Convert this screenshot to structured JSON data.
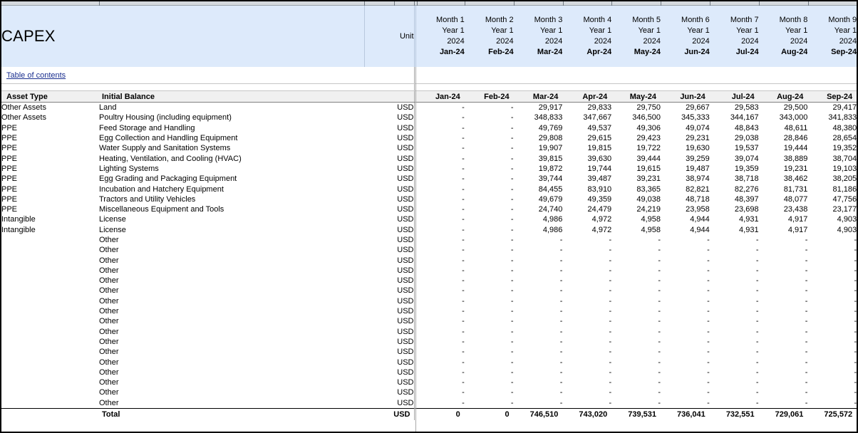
{
  "header": {
    "title": "CAPEX",
    "unit_label": "Unit",
    "toc_link": "Table of contents",
    "months": [
      {
        "month": "Month 1",
        "year_label": "Year 1",
        "year": "2024",
        "date": "Jan-24"
      },
      {
        "month": "Month 2",
        "year_label": "Year 1",
        "year": "2024",
        "date": "Feb-24"
      },
      {
        "month": "Month 3",
        "year_label": "Year 1",
        "year": "2024",
        "date": "Mar-24"
      },
      {
        "month": "Month 4",
        "year_label": "Year 1",
        "year": "2024",
        "date": "Apr-24"
      },
      {
        "month": "Month 5",
        "year_label": "Year 1",
        "year": "2024",
        "date": "May-24"
      },
      {
        "month": "Month 6",
        "year_label": "Year 1",
        "year": "2024",
        "date": "Jun-24"
      },
      {
        "month": "Month 7",
        "year_label": "Year 1",
        "year": "2024",
        "date": "Jul-24"
      },
      {
        "month": "Month 8",
        "year_label": "Year 1",
        "year": "2024",
        "date": "Aug-24"
      },
      {
        "month": "Month 9",
        "year_label": "Year 1",
        "year": "2024",
        "date": "Sep-24"
      }
    ]
  },
  "table": {
    "columns": {
      "asset_type": "Asset Type",
      "initial_balance": "Initial Balance",
      "unit": "",
      "months": [
        "Jan-24",
        "Feb-24",
        "Mar-24",
        "Apr-24",
        "May-24",
        "Jun-24",
        "Jul-24",
        "Aug-24",
        "Sep-24"
      ]
    },
    "rows": [
      {
        "type": "Other Assets",
        "desc": "Land",
        "unit": "USD",
        "values": [
          "-",
          "-",
          "29,917",
          "29,833",
          "29,750",
          "29,667",
          "29,583",
          "29,500",
          "29,417"
        ]
      },
      {
        "type": "Other Assets",
        "desc": "Poultry Housing (including equipment)",
        "unit": "USD",
        "values": [
          "-",
          "-",
          "348,833",
          "347,667",
          "346,500",
          "345,333",
          "344,167",
          "343,000",
          "341,833"
        ]
      },
      {
        "type": "PPE",
        "desc": "Feed Storage and Handling",
        "unit": "USD",
        "values": [
          "-",
          "-",
          "49,769",
          "49,537",
          "49,306",
          "49,074",
          "48,843",
          "48,611",
          "48,380"
        ]
      },
      {
        "type": "PPE",
        "desc": "Egg Collection and Handling Equipment",
        "unit": "USD",
        "values": [
          "-",
          "-",
          "29,808",
          "29,615",
          "29,423",
          "29,231",
          "29,038",
          "28,846",
          "28,654"
        ]
      },
      {
        "type": "PPE",
        "desc": "Water Supply and Sanitation Systems",
        "unit": "USD",
        "values": [
          "-",
          "-",
          "19,907",
          "19,815",
          "19,722",
          "19,630",
          "19,537",
          "19,444",
          "19,352"
        ]
      },
      {
        "type": "PPE",
        "desc": "Heating, Ventilation, and Cooling (HVAC)",
        "unit": "USD",
        "values": [
          "-",
          "-",
          "39,815",
          "39,630",
          "39,444",
          "39,259",
          "39,074",
          "38,889",
          "38,704"
        ]
      },
      {
        "type": "PPE",
        "desc": "Lighting Systems",
        "unit": "USD",
        "values": [
          "-",
          "-",
          "19,872",
          "19,744",
          "19,615",
          "19,487",
          "19,359",
          "19,231",
          "19,103"
        ]
      },
      {
        "type": "PPE",
        "desc": "Egg Grading and Packaging Equipment",
        "unit": "USD",
        "values": [
          "-",
          "-",
          "39,744",
          "39,487",
          "39,231",
          "38,974",
          "38,718",
          "38,462",
          "38,205"
        ]
      },
      {
        "type": "PPE",
        "desc": "Incubation and Hatchery Equipment",
        "unit": "USD",
        "values": [
          "-",
          "-",
          "84,455",
          "83,910",
          "83,365",
          "82,821",
          "82,276",
          "81,731",
          "81,186"
        ]
      },
      {
        "type": "PPE",
        "desc": "Tractors and Utility Vehicles",
        "unit": "USD",
        "values": [
          "-",
          "-",
          "49,679",
          "49,359",
          "49,038",
          "48,718",
          "48,397",
          "48,077",
          "47,756"
        ]
      },
      {
        "type": "PPE",
        "desc": "Miscellaneous Equipment and Tools",
        "unit": "USD",
        "values": [
          "-",
          "-",
          "24,740",
          "24,479",
          "24,219",
          "23,958",
          "23,698",
          "23,438",
          "23,177"
        ]
      },
      {
        "type": "Intangible",
        "desc": "License",
        "unit": "USD",
        "values": [
          "-",
          "-",
          "4,986",
          "4,972",
          "4,958",
          "4,944",
          "4,931",
          "4,917",
          "4,903"
        ]
      },
      {
        "type": "Intangible",
        "desc": "License",
        "unit": "USD",
        "values": [
          "-",
          "-",
          "4,986",
          "4,972",
          "4,958",
          "4,944",
          "4,931",
          "4,917",
          "4,903"
        ]
      },
      {
        "type": "",
        "desc": "Other",
        "unit": "USD",
        "values": [
          "-",
          "-",
          "-",
          "-",
          "-",
          "-",
          "-",
          "-",
          "-"
        ]
      },
      {
        "type": "",
        "desc": "Other",
        "unit": "USD",
        "values": [
          "-",
          "-",
          "-",
          "-",
          "-",
          "-",
          "-",
          "-",
          "-"
        ]
      },
      {
        "type": "",
        "desc": "Other",
        "unit": "USD",
        "values": [
          "-",
          "-",
          "-",
          "-",
          "-",
          "-",
          "-",
          "-",
          "-"
        ]
      },
      {
        "type": "",
        "desc": "Other",
        "unit": "USD",
        "values": [
          "-",
          "-",
          "-",
          "-",
          "-",
          "-",
          "-",
          "-",
          "-"
        ]
      },
      {
        "type": "",
        "desc": "Other",
        "unit": "USD",
        "values": [
          "-",
          "-",
          "-",
          "-",
          "-",
          "-",
          "-",
          "-",
          "-"
        ]
      },
      {
        "type": "",
        "desc": "Other",
        "unit": "USD",
        "values": [
          "-",
          "-",
          "-",
          "-",
          "-",
          "-",
          "-",
          "-",
          "-"
        ]
      },
      {
        "type": "",
        "desc": "Other",
        "unit": "USD",
        "values": [
          "-",
          "-",
          "-",
          "-",
          "-",
          "-",
          "-",
          "-",
          "-"
        ]
      },
      {
        "type": "",
        "desc": "Other",
        "unit": "USD",
        "values": [
          "-",
          "-",
          "-",
          "-",
          "-",
          "-",
          "-",
          "-",
          "-"
        ]
      },
      {
        "type": "",
        "desc": "Other",
        "unit": "USD",
        "values": [
          "-",
          "-",
          "-",
          "-",
          "-",
          "-",
          "-",
          "-",
          "-"
        ]
      },
      {
        "type": "",
        "desc": "Other",
        "unit": "USD",
        "values": [
          "-",
          "-",
          "-",
          "-",
          "-",
          "-",
          "-",
          "-",
          "-"
        ]
      },
      {
        "type": "",
        "desc": "Other",
        "unit": "USD",
        "values": [
          "-",
          "-",
          "-",
          "-",
          "-",
          "-",
          "-",
          "-",
          "-"
        ]
      },
      {
        "type": "",
        "desc": "Other",
        "unit": "USD",
        "values": [
          "-",
          "-",
          "-",
          "-",
          "-",
          "-",
          "-",
          "-",
          "-"
        ]
      },
      {
        "type": "",
        "desc": "Other",
        "unit": "USD",
        "values": [
          "-",
          "-",
          "-",
          "-",
          "-",
          "-",
          "-",
          "-",
          "-"
        ]
      },
      {
        "type": "",
        "desc": "Other",
        "unit": "USD",
        "values": [
          "-",
          "-",
          "-",
          "-",
          "-",
          "-",
          "-",
          "-",
          "-"
        ]
      },
      {
        "type": "",
        "desc": "Other",
        "unit": "USD",
        "values": [
          "-",
          "-",
          "-",
          "-",
          "-",
          "-",
          "-",
          "-",
          "-"
        ]
      },
      {
        "type": "",
        "desc": "Other",
        "unit": "USD",
        "values": [
          "-",
          "-",
          "-",
          "-",
          "-",
          "-",
          "-",
          "-",
          "-"
        ]
      },
      {
        "type": "",
        "desc": "Other",
        "unit": "USD",
        "values": [
          "-",
          "-",
          "-",
          "-",
          "-",
          "-",
          "-",
          "-",
          "-"
        ]
      }
    ],
    "total": {
      "type": "",
      "desc": "Total",
      "unit": "USD",
      "values": [
        "0",
        "0",
        "746,510",
        "743,020",
        "739,531",
        "736,041",
        "732,551",
        "729,061",
        "725,572"
      ]
    }
  },
  "colors": {
    "header_band": "#ddeafb",
    "column_header": "#f0f0f0",
    "link": "#1a2f8f",
    "grid_line": "#c6c6c6",
    "strong_line": "#808080"
  }
}
